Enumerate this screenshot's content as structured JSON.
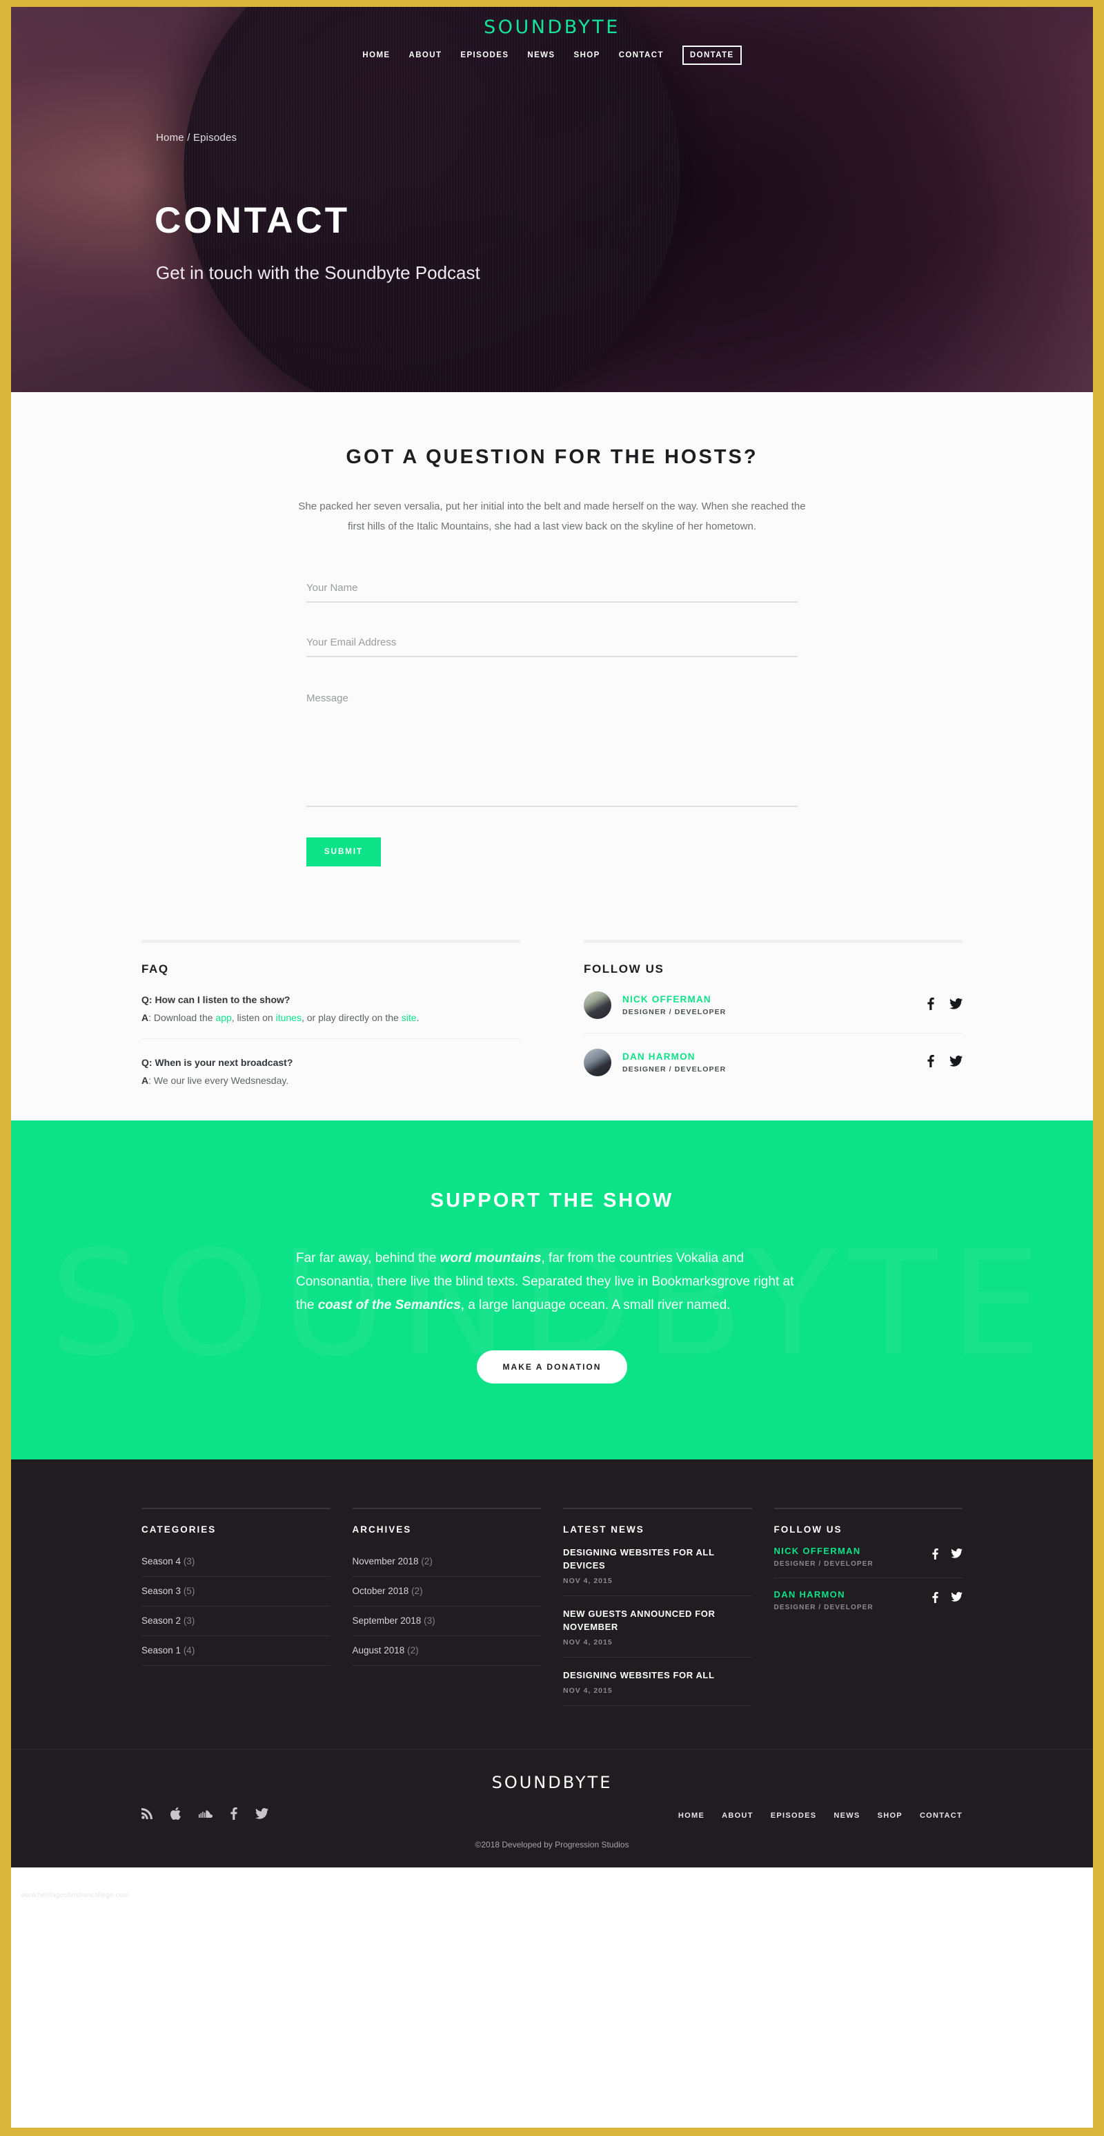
{
  "brand": {
    "logo": "SOUNDBYTE",
    "accent": "#0ce287",
    "frame": "#d9b63a"
  },
  "nav": {
    "items": [
      {
        "label": "HOME"
      },
      {
        "label": "ABOUT"
      },
      {
        "label": "EPISODES"
      },
      {
        "label": "NEWS"
      },
      {
        "label": "SHOP"
      },
      {
        "label": "CONTACT"
      }
    ],
    "cta": "DONTATE"
  },
  "hero": {
    "breadcrumb_home": "Home",
    "breadcrumb_sep": "/",
    "breadcrumb_current": "Episodes",
    "title": "CONTACT",
    "subtitle": "Get in touch with the Soundbyte Podcast"
  },
  "contact": {
    "heading": "GOT A QUESTION FOR THE HOSTS?",
    "description": "She packed her seven versalia, put her initial into the belt and made herself on the way. When she reached the first hills of the Italic Mountains, she had a last view back on the skyline of her hometown.",
    "name_placeholder": "Your Name",
    "name_value": "",
    "email_placeholder": "Your Email Address",
    "email_value": "",
    "message_placeholder": "Message",
    "message_value": "",
    "submit_label": "SUBMIT"
  },
  "faq": {
    "heading": "FAQ",
    "items": [
      {
        "q": "Q: How can I listen to the show?",
        "a_prefix": "A",
        "a_p1": ": Download the ",
        "link1": "app",
        "a_p2": ", listen on ",
        "link2": "itunes",
        "a_p3": ", or play directly on the ",
        "link3": "site",
        "a_p4": "."
      },
      {
        "q": "Q: When is your next broadcast?",
        "a_prefix": "A",
        "a_p1": ": We our live every Wedsnesday.",
        "link1": "",
        "a_p2": "",
        "link2": "",
        "a_p3": "",
        "link3": "",
        "a_p4": ""
      }
    ]
  },
  "follow": {
    "heading": "FOLLOW US",
    "hosts": [
      {
        "name": "NICK OFFERMAN",
        "role": "DESIGNER / DEVELOPER"
      },
      {
        "name": "DAN HARMON",
        "role": "DESIGNER / DEVELOPER"
      }
    ]
  },
  "support": {
    "ghost_text": "SOUNDBYTE",
    "heading": "SUPPORT THE SHOW",
    "p1": "Far far away, behind the ",
    "em1": "word mountains",
    "p2": ", far from the countries Vokalia and Consonantia, there live the blind texts. Separated they live in Bookmarksgrove right at the ",
    "em2": "coast of the Semantics",
    "p3": ", a large language ocean. A small river named.",
    "button": "MAKE A DONATION"
  },
  "footer": {
    "categories": {
      "heading": "CATEGORIES",
      "items": [
        {
          "label": "Season 4",
          "count": "(3)"
        },
        {
          "label": "Season 3",
          "count": "(5)"
        },
        {
          "label": "Season 2",
          "count": "(3)"
        },
        {
          "label": "Season 1",
          "count": "(4)"
        }
      ]
    },
    "archives": {
      "heading": "ARCHIVES",
      "items": [
        {
          "label": "November 2018",
          "count": "(2)"
        },
        {
          "label": "October 2018",
          "count": "(2)"
        },
        {
          "label": "September 2018",
          "count": "(3)"
        },
        {
          "label": "August 2018",
          "count": "(2)"
        }
      ]
    },
    "latest_news": {
      "heading": "LATEST NEWS",
      "items": [
        {
          "title": "DESIGNING WEBSITES FOR ALL DEVICES",
          "date": "NOV 4, 2015"
        },
        {
          "title": "NEW GUESTS ANNOUNCED FOR NOVEMBER",
          "date": "NOV 4, 2015"
        },
        {
          "title": "DESIGNING WEBSITES FOR ALL",
          "date": "NOV 4, 2015"
        }
      ]
    },
    "follow": {
      "heading": "FOLLOW US",
      "hosts": [
        {
          "name": "NICK OFFERMAN",
          "role": "DESIGNER / DEVELOPER"
        },
        {
          "name": "DAN HARMON",
          "role": "DESIGNER / DEVELOPER"
        }
      ]
    },
    "bottom": {
      "logo": "SOUNDBYTE",
      "nav": [
        {
          "label": "HOME"
        },
        {
          "label": "ABOUT"
        },
        {
          "label": "EPISODES"
        },
        {
          "label": "NEWS"
        },
        {
          "label": "SHOP"
        },
        {
          "label": "CONTACT"
        }
      ],
      "copyright": "©2018 Developed by Progression Studios",
      "watermark": "www.heritagechristiancollege.com"
    }
  }
}
